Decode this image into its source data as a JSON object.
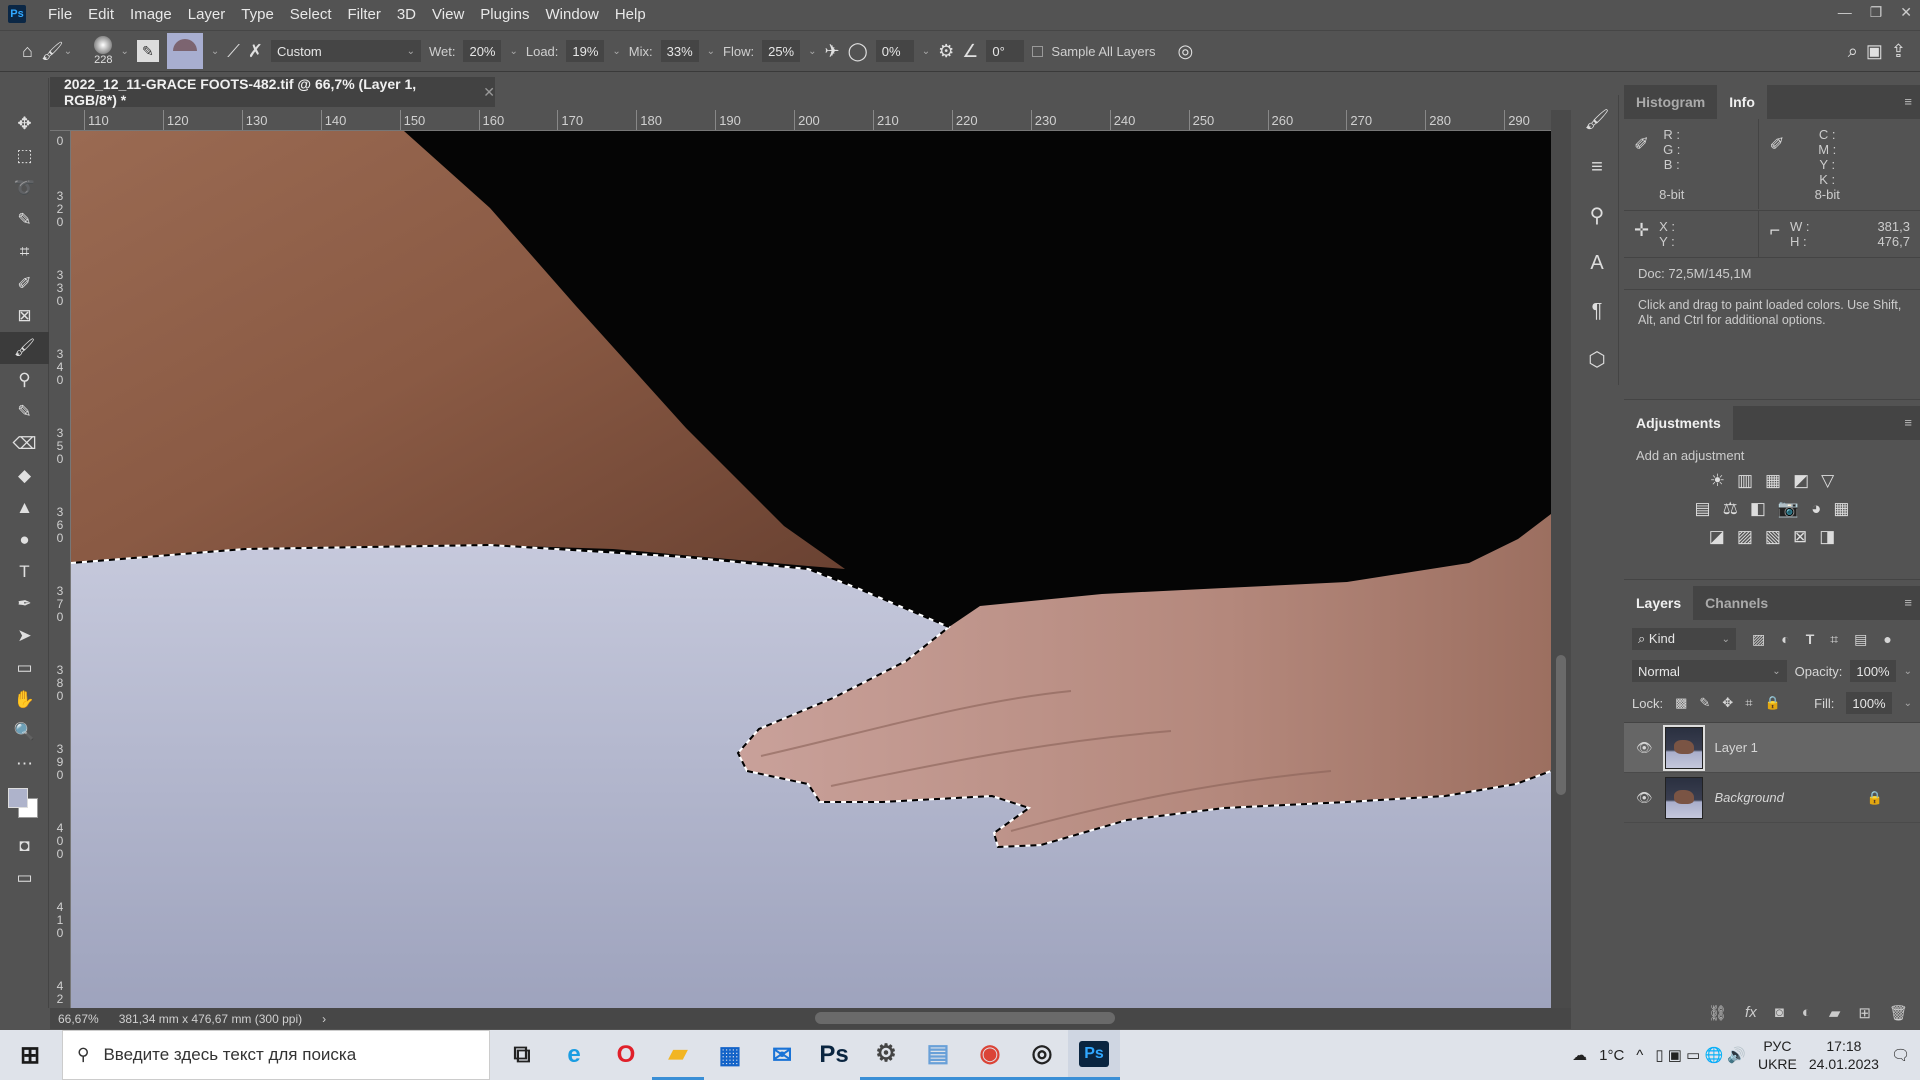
{
  "app": {
    "logo": "Ps",
    "menu": [
      "File",
      "Edit",
      "Image",
      "Layer",
      "Type",
      "Select",
      "Filter",
      "3D",
      "View",
      "Plugins",
      "Window",
      "Help"
    ]
  },
  "options": {
    "brush_size": "228",
    "preset": "Custom",
    "wet_label": "Wet:",
    "wet": "20%",
    "load_label": "Load:",
    "load": "19%",
    "mix_label": "Mix:",
    "mix": "33%",
    "flow_label": "Flow:",
    "flow": "25%",
    "smoothing": "0%",
    "angle": "0°",
    "sample_all_layers": "Sample All Layers",
    "sample_all_checked": false
  },
  "document": {
    "tab_title": "2022_12_11-GRACE FOOTS-482.tif @ 66,7% (Layer 1, RGB/8*) *"
  },
  "rulers": {
    "top": [
      "110",
      "120",
      "130",
      "140",
      "150",
      "160",
      "170",
      "180",
      "190",
      "200",
      "210",
      "220",
      "230",
      "240",
      "250",
      "260",
      "270",
      "280",
      "290"
    ],
    "left": [
      "0",
      "320",
      "330",
      "340",
      "350",
      "360",
      "370",
      "380",
      "390",
      "400",
      "410",
      "42"
    ]
  },
  "status": {
    "zoom": "66,67%",
    "doc_size": "381,34 mm x 476,67 mm (300 ppi)"
  },
  "tools": [
    "move",
    "marquee",
    "lasso",
    "quick-select",
    "crop",
    "eyedropper",
    "frame",
    "mixer-brush",
    "clone-stamp",
    "history-brush",
    "eraser",
    "paint-bucket",
    "sharpen",
    "dodge",
    "type",
    "pen",
    "path-select",
    "rectangle",
    "hand",
    "zoom",
    "more"
  ],
  "tool_glyphs": [
    "✥",
    "⬚",
    "➰",
    "✎",
    "⌗",
    "✐",
    "⊠",
    "🖌",
    "⚲",
    "✎",
    "⌫",
    "◆",
    "▲",
    "●",
    "T",
    "✒",
    "➤",
    "▭",
    "✋",
    "🔍",
    "⋯"
  ],
  "info_panel": {
    "tabs": [
      "Histogram",
      "Info"
    ],
    "active_tab": "Info",
    "rgb_labels": [
      "R :",
      "G :",
      "B :"
    ],
    "rgb_bit": "8-bit",
    "cmyk_labels": [
      "C :",
      "M :",
      "Y :",
      "K :"
    ],
    "cmyk_bit": "8-bit",
    "xy_labels": [
      "X :",
      "Y :"
    ],
    "w_label": "W :",
    "w_value": "381,3",
    "h_label": "H :",
    "h_value": "476,7",
    "doc": "Doc: 72,5M/145,1M",
    "hint": "Click and drag to paint loaded colors.  Use Shift, Alt, and Ctrl for additional options."
  },
  "adjustments": {
    "title": "Adjustments",
    "subtitle": "Add an adjustment",
    "rows": [
      [
        "☀",
        "▥",
        "▦",
        "◩",
        "▽"
      ],
      [
        "▤",
        "⚖",
        "◧",
        "📷",
        "◕",
        "▦"
      ],
      [
        "◪",
        "▨",
        "▧",
        "⊠",
        "◨"
      ]
    ]
  },
  "layers": {
    "tabs": [
      "Layers",
      "Channels"
    ],
    "active_tab": "Layers",
    "filter": "Kind",
    "blend_mode": "Normal",
    "opacity_label": "Opacity:",
    "opacity": "100%",
    "lock_label": "Lock:",
    "fill_label": "Fill:",
    "fill": "100%",
    "items": [
      {
        "name": "Layer 1",
        "visible": true,
        "selected": true,
        "locked": false
      },
      {
        "name": "Background",
        "visible": true,
        "selected": false,
        "locked": true
      }
    ],
    "footer_icons": [
      "link",
      "fx",
      "mask",
      "adjustment",
      "group",
      "new-layer",
      "delete"
    ]
  },
  "taskbar": {
    "search_placeholder": "Введите здесь текст для поиска",
    "weather": "1°C",
    "lang_top": "РУС",
    "lang_bottom": "UKRE",
    "time": "17:18",
    "date": "24.01.2023",
    "apps": [
      "task-view",
      "edge",
      "opera",
      "file-explorer",
      "store",
      "mail",
      "photoshop-dark",
      "settings",
      "notepad",
      "chrome",
      "obs",
      "photoshop"
    ]
  },
  "colors": {
    "accent": "#31a8ff",
    "panel": "#535353",
    "canvas_bg": "#050505",
    "surface": "#aeb3cb",
    "skin": "#8a5a44"
  }
}
